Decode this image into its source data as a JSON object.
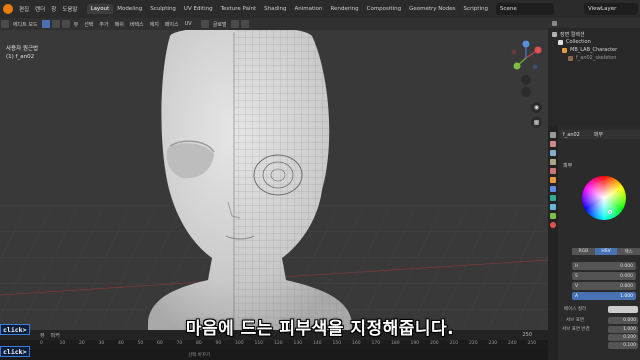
{
  "menus": [
    "편집",
    "렌더",
    "창",
    "도움말"
  ],
  "workspaces": [
    "Layout",
    "Modeling",
    "Sculpting",
    "UV Editing",
    "Texture Paint",
    "Shading",
    "Animation",
    "Rendering",
    "Compositing",
    "Geometry Nodes",
    "Scripting"
  ],
  "active_workspace": "Layout",
  "scene": {
    "label": "Scene",
    "view_layer": "ViewLayer"
  },
  "viewport_header": {
    "mode": "에디트 모드",
    "menus": [
      "뷰",
      "선택",
      "추가",
      "메쉬",
      "버텍스",
      "에지",
      "페이스",
      "UV"
    ],
    "transform": "글로벌"
  },
  "viewport_info": {
    "view": "사용자 원근법",
    "object": "(1) f_an02"
  },
  "outliner": {
    "title": "장면 컬렉션",
    "rows": [
      "Collection",
      "MB_LAB_Character",
      "f_an02_skeleton"
    ]
  },
  "properties": {
    "object": "f_an02",
    "material": "피부",
    "section": "피부",
    "color_modes": [
      "RGB",
      "HSV",
      "헥스"
    ],
    "active_mode": "HSV",
    "hsv": [
      {
        "label": "H",
        "value": "0.000"
      },
      {
        "label": "S",
        "value": "0.000"
      },
      {
        "label": "V",
        "value": "0.800"
      },
      {
        "label": "A",
        "value": "1.000"
      }
    ],
    "params": [
      {
        "label": "베이스 컬러",
        "value": ""
      },
      {
        "label": "서브 표면",
        "value": "0.000"
      },
      {
        "label": "서브 표면 반경",
        "value": "1.000"
      },
      {
        "label": "",
        "value": "0.200"
      },
      {
        "label": "",
        "value": "0.100"
      }
    ]
  },
  "timeline": {
    "menus": [
      "뷰",
      "마커"
    ],
    "ticks": [
      "0",
      "10",
      "20",
      "30",
      "40",
      "50",
      "60",
      "70",
      "80",
      "90",
      "100",
      "110",
      "120",
      "130",
      "140",
      "150",
      "160",
      "170",
      "180",
      "190",
      "200",
      "210",
      "220",
      "230",
      "240",
      "250"
    ],
    "start": "250",
    "status": "선택 바꾸기"
  },
  "overlay_buttons": [
    "click>",
    "click>"
  ],
  "subtitle": "마음에 드는 피부색을 지정해줍니다.",
  "colors": {
    "accent": "#4772b3",
    "blender_orange": "#e87d0d",
    "click_border": "#3b7ddd"
  }
}
